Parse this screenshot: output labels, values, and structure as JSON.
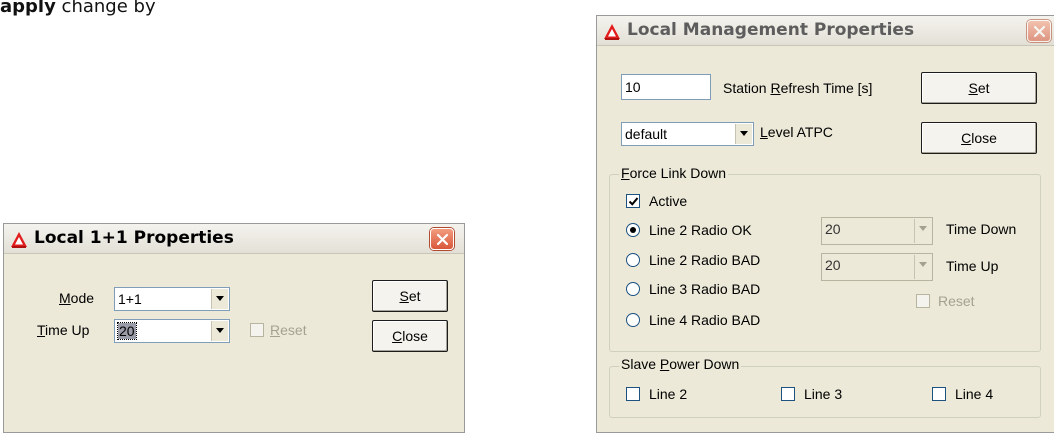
{
  "page": {
    "heading_bold": "apply",
    "heading_normal": " change by"
  },
  "local_1plus1": {
    "title": "Local 1+1 Properties",
    "mode": {
      "accel": "M",
      "label_rest": "ode",
      "value": "1+1"
    },
    "time_up": {
      "accel": "T",
      "label_rest": "ime Up",
      "value": "20"
    },
    "reset": {
      "accel": "R",
      "label_rest": "eset",
      "checked": false,
      "enabled": false
    },
    "set_button": {
      "accel": "S",
      "label_rest": "et"
    },
    "close_button": {
      "accel": "C",
      "label_rest": "lose"
    }
  },
  "local_mgmt": {
    "title": "Local Management Properties",
    "refresh": {
      "value": "10",
      "label_pre": "Station ",
      "accel": "R",
      "label_post": "efresh Time [s]"
    },
    "atpc": {
      "value": "default",
      "accel": "L",
      "label_rest": "evel ATPC"
    },
    "set_button": {
      "accel": "S",
      "label_rest": "et"
    },
    "close_button": {
      "accel": "C",
      "label_rest": "lose"
    },
    "force_link_down": {
      "legend_accel": "F",
      "legend_rest": "orce Link Down",
      "active": {
        "label": "Active",
        "checked": true
      },
      "options": [
        {
          "label": "Line 2 Radio OK",
          "selected": true
        },
        {
          "label": "Line 2 Radio BAD",
          "selected": false
        },
        {
          "label": "Line 3 Radio BAD",
          "selected": false
        },
        {
          "label": "Line 4 Radio BAD",
          "selected": false
        }
      ],
      "time_down": {
        "value": "20",
        "label": "Time Down"
      },
      "time_up": {
        "value": "20",
        "label": "Time Up"
      },
      "reset": {
        "label": "Reset",
        "checked": false,
        "enabled": false
      }
    },
    "slave_power_down": {
      "legend_pre": "Slave ",
      "legend_accel": "P",
      "legend_post": "ower Down",
      "lines": [
        {
          "label": "Line 2",
          "checked": false
        },
        {
          "label": "Line 3",
          "checked": false
        },
        {
          "label": "Line 4",
          "checked": false
        }
      ]
    }
  },
  "colors": {
    "dialog_face": "#ece9d8",
    "close_button_red": "#d9573a",
    "logo_red": "#e11d1d"
  },
  "icons": {
    "app_logo": "red-triangle-logo-icon",
    "close": "close-icon",
    "dropdown": "chevron-down-icon",
    "check": "checkmark-icon"
  }
}
